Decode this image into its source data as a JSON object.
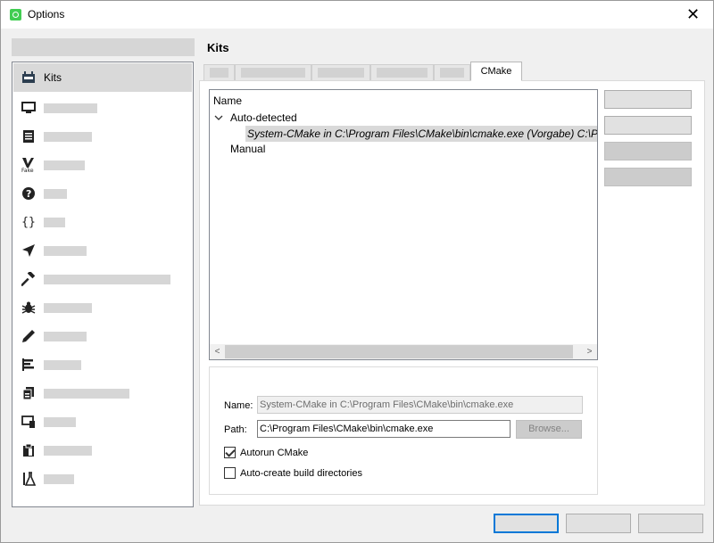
{
  "window": {
    "title": "Options",
    "close_glyph": "✕",
    "app_icon": "qt-creator-icon"
  },
  "sidebar": {
    "items": [
      {
        "icon": "kits-icon",
        "glyph": "⚙",
        "label": "Kits",
        "selected": true
      },
      {
        "icon": "environment-icon",
        "glyph": "🖵",
        "label": ""
      },
      {
        "icon": "text-editor-icon",
        "glyph": "▤",
        "label": ""
      },
      {
        "icon": "fakevim-icon",
        "glyph": "V",
        "label": ""
      },
      {
        "icon": "help-icon",
        "glyph": "?",
        "label": ""
      },
      {
        "icon": "cpp-icon",
        "glyph": "{}",
        "label": ""
      },
      {
        "icon": "qtquick-icon",
        "glyph": "➤",
        "label": ""
      },
      {
        "icon": "build-run-icon",
        "glyph": "⚒",
        "label": ""
      },
      {
        "icon": "debugger-icon",
        "glyph": "✱",
        "label": ""
      },
      {
        "icon": "designer-icon",
        "glyph": "✎",
        "label": ""
      },
      {
        "icon": "analyzer-icon",
        "glyph": "▦",
        "label": ""
      },
      {
        "icon": "version-control-icon",
        "glyph": "▧",
        "label": ""
      },
      {
        "icon": "devices-icon",
        "glyph": "▭",
        "label": ""
      },
      {
        "icon": "code-pasting-icon",
        "glyph": "▥",
        "label": ""
      },
      {
        "icon": "testing-icon",
        "glyph": "⚗",
        "label": ""
      }
    ]
  },
  "page": {
    "title": "Kits",
    "tabs": [
      {
        "label": ""
      },
      {
        "label": ""
      },
      {
        "label": ""
      },
      {
        "label": ""
      },
      {
        "label": ""
      },
      {
        "label": "CMake",
        "active": true
      }
    ]
  },
  "tree": {
    "header": "Name",
    "groups": [
      {
        "label": "Auto-detected",
        "expanded": true
      },
      {
        "label": "Manual"
      }
    ],
    "selected_item": "System-CMake in C:\\Program Files\\CMake\\bin\\cmake.exe (Vorgabe)  C:\\P..."
  },
  "details": {
    "name_label": "Name:",
    "name_value": "System-CMake in C:\\Program Files\\CMake\\bin\\cmake.exe",
    "path_label": "Path:",
    "path_value": "C:\\Program Files\\CMake\\bin\\cmake.exe",
    "browse_label": "Browse...",
    "autorun_label": "Autorun CMake",
    "autorun_checked": true,
    "autocreate_label": "Auto-create build directories",
    "autocreate_checked": false
  },
  "dialog_buttons": [
    {
      "label": "",
      "default": true
    },
    {
      "label": ""
    },
    {
      "label": ""
    }
  ]
}
